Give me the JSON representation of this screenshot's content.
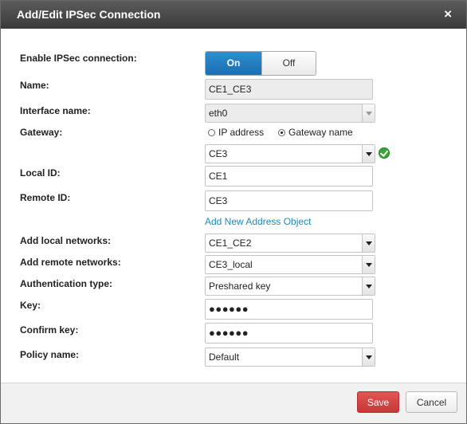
{
  "dialog": {
    "title": "Add/Edit IPSec Connection",
    "close_glyph": "×"
  },
  "form": {
    "enable": {
      "label": "Enable IPSec connection:",
      "on": "On",
      "off": "Off",
      "selected": "On"
    },
    "name": {
      "label": "Name:",
      "value": "CE1_CE3"
    },
    "interface": {
      "label": "Interface name:",
      "value": "eth0"
    },
    "gateway": {
      "label": "Gateway:",
      "option_ip": "IP address",
      "option_name": "Gateway name",
      "selected": "Gateway name",
      "value": "CE3",
      "status_icon": "check-circle-icon"
    },
    "local_id": {
      "label": "Local ID:",
      "value": "CE1"
    },
    "remote_id": {
      "label": "Remote ID:",
      "value": "CE3"
    },
    "add_address_link": "Add New Address Object",
    "local_networks": {
      "label": "Add local networks:",
      "value": "CE1_CE2"
    },
    "remote_networks": {
      "label": "Add remote networks:",
      "value": "CE3_local"
    },
    "auth_type": {
      "label": "Authentication type:",
      "value": "Preshared key"
    },
    "key": {
      "label": "Key:",
      "value": "●●●●●●"
    },
    "confirm_key": {
      "label": "Confirm key:",
      "value": "●●●●●●"
    },
    "policy": {
      "label": "Policy name:",
      "value": "Default"
    }
  },
  "footer": {
    "save": "Save",
    "cancel": "Cancel"
  },
  "colors": {
    "titlebar": "#4a4a4a",
    "toggle_on": "#1d6fb0",
    "save_button": "#c83737",
    "link": "#1e8ab8",
    "ok_icon": "#3aa53a"
  }
}
